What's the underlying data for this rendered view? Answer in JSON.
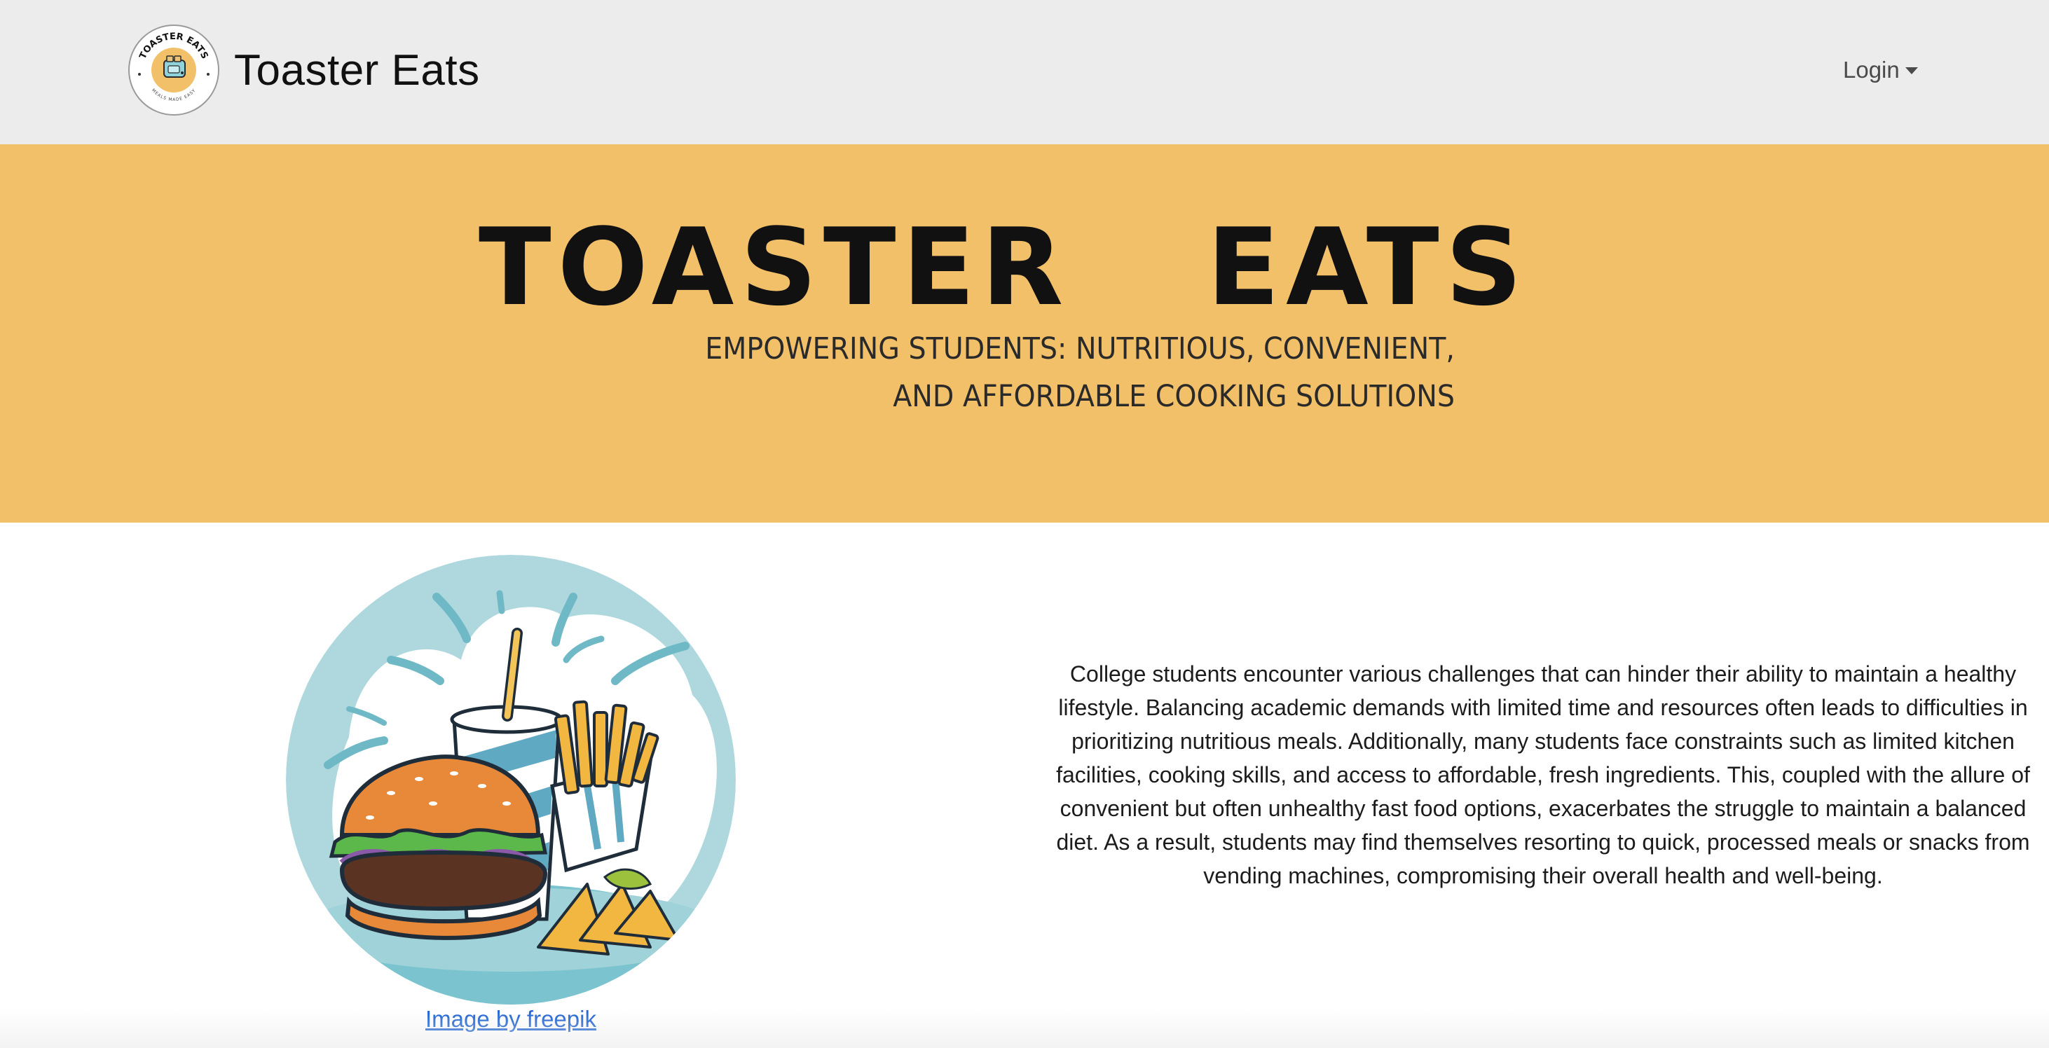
{
  "navbar": {
    "brand_name": "Toaster Eats",
    "logo": {
      "icon": "toaster-icon",
      "ring_text_top": "TOASTER EATS",
      "ring_text_bottom": "MEALS MADE EASY"
    },
    "login_label": "Login",
    "background_color": "#ececec"
  },
  "hero": {
    "title": "TOASTER  EATS",
    "subtitle_line1": "EMPOWERING STUDENTS: NUTRITIOUS, CONVENIENT,",
    "subtitle_line2": "AND AFFORDABLE COOKING SOLUTIONS",
    "background_color": "#f3c06a"
  },
  "content": {
    "image_icon": "burger-fries-soda-illustration",
    "image_credit": "Image by freepik",
    "description": "College students encounter various challenges that can hinder their ability to maintain a healthy lifestyle. Balancing academic demands with limited time and resources often leads to difficulties in prioritizing nutritious meals. Additionally, many students face constraints such as limited kitchen facilities, cooking skills, and access to affordable, fresh ingredients. This, coupled with the allure of convenient but often unhealthy fast food options, exacerbates the struggle to maintain a balanced diet. As a result, students may find themselves resorting to quick, processed meals or snacks from vending machines, compromising their overall health and well-being.",
    "link_color": "#1a5fd0"
  }
}
